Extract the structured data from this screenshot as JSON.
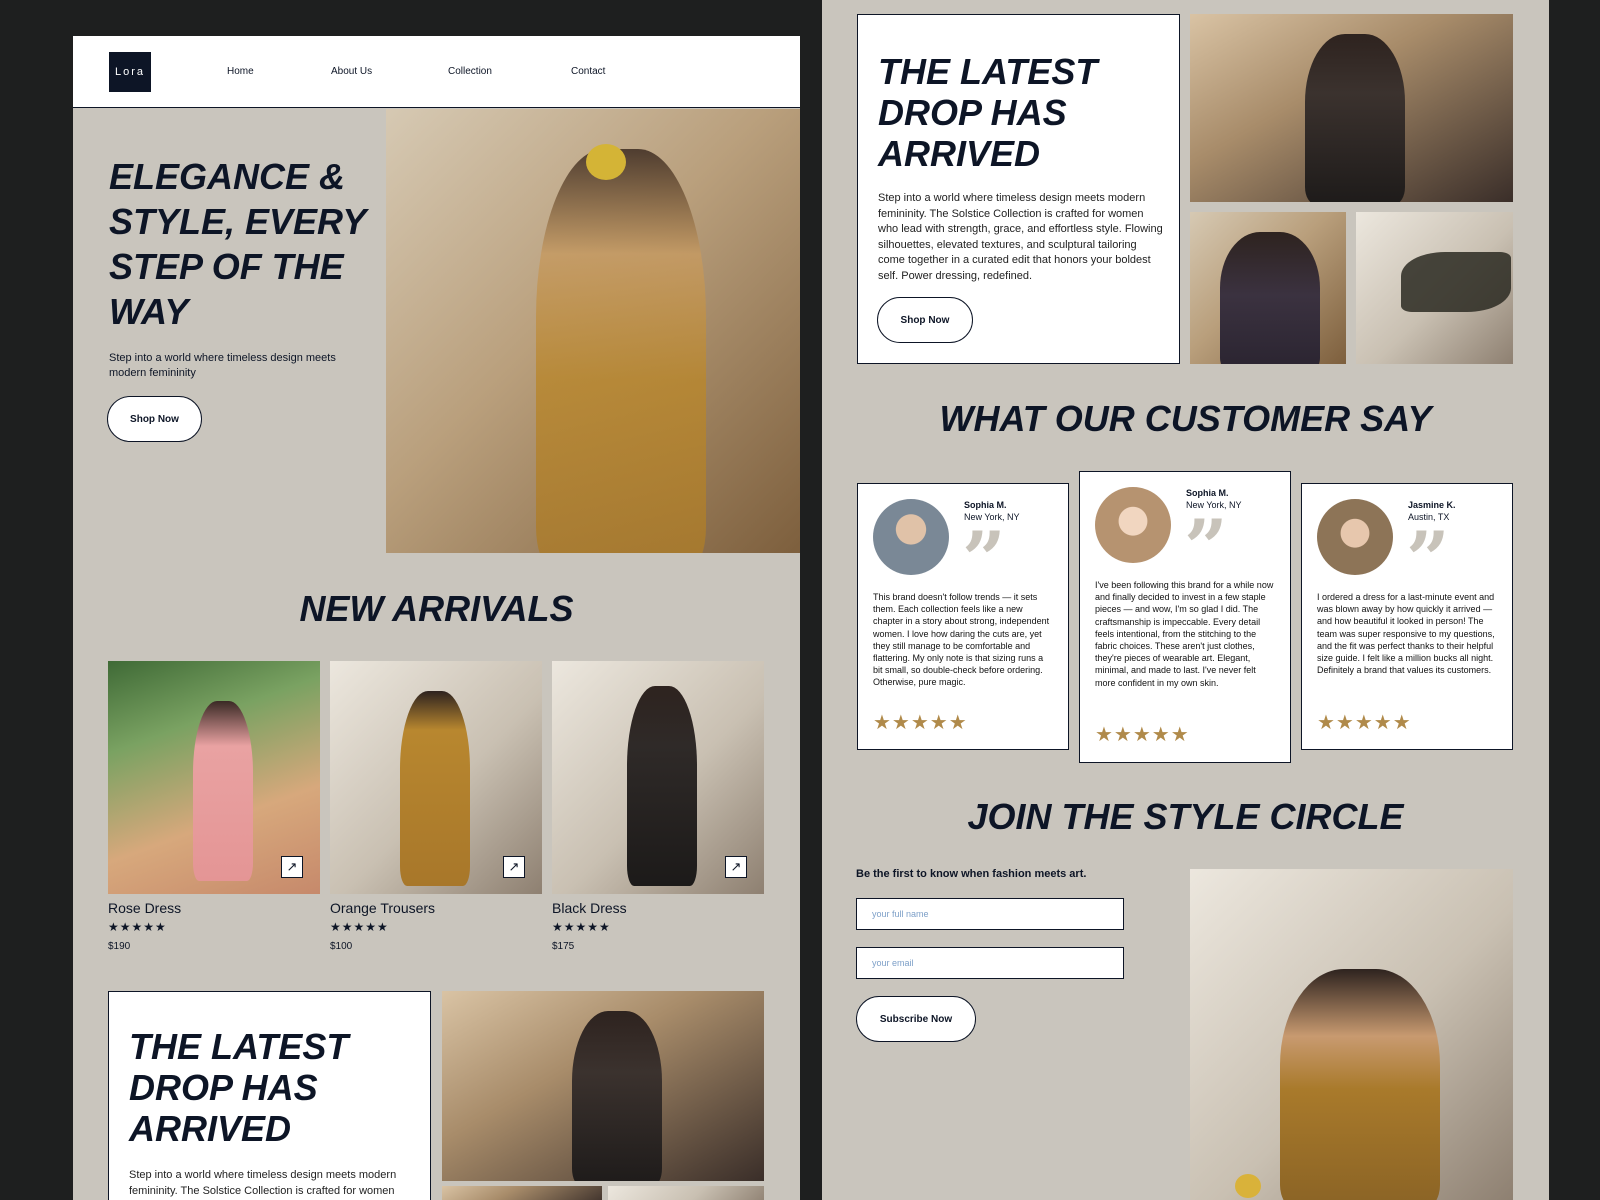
{
  "nav": {
    "logo": "Lora",
    "links": [
      "Home",
      "About Us",
      "Collection",
      "Contact"
    ]
  },
  "hero": {
    "title": "ELEGANCE & STYLE, EVERY STEP OF THE WAY",
    "subtitle": "Step into a world where timeless design meets modern femininity",
    "button": "Shop Now"
  },
  "new_arrivals": {
    "title": "NEW ARRIVALS",
    "products": [
      {
        "name": "Rose Dress",
        "stars": "★★★★★",
        "price": "$190"
      },
      {
        "name": "Orange Trousers",
        "stars": "★★★★★",
        "price": "$100"
      },
      {
        "name": "Black Dress",
        "stars": "★★★★★",
        "price": "$175"
      }
    ],
    "arrow_icon": "↗"
  },
  "latest_drop": {
    "title": "THE LATEST DROP HAS ARRIVED",
    "body": "Step into a world where timeless design meets modern femininity. The Solstice Collection is crafted for women who lead with strength, grace, and effortless style. Flowing silhouettes, elevated textures, and sculptural tailoring come together in a curated edit that honors your boldest self. Power dressing, redefined.",
    "body_short": "Step into a world where timeless design meets modern femininity. The Solstice Collection is crafted for women",
    "button": "Shop Now"
  },
  "testimonials": {
    "title": "WHAT OUR CUSTOMER SAY",
    "reviews": [
      {
        "name": "Sophia M.",
        "location": "New York, NY",
        "stars": "★★★★★",
        "text": "This brand doesn't follow trends — it sets them. Each collection feels like a new chapter in a story about strong, independent women. I love how daring the cuts are, yet they still manage to be comfortable and flattering. My only note is that sizing runs a bit small, so double-check before ordering. Otherwise, pure magic."
      },
      {
        "name": "Sophia M.",
        "location": "New York, NY",
        "stars": "★★★★★",
        "text": "I've been following this brand for a while now and finally decided to invest in a few staple pieces — and wow, I'm so glad I did. The craftsmanship is impeccable. Every detail feels intentional, from the stitching to the fabric choices. These aren't just clothes, they're pieces of wearable art. Elegant, minimal, and made to last. I've never felt more confident in my own skin."
      },
      {
        "name": "Jasmine K.",
        "location": "Austin, TX",
        "stars": "★★★★★",
        "text": "I ordered a dress for a last-minute event and was blown away by how quickly it arrived — and how beautiful it looked in person! The team was super responsive to my questions, and the fit was perfect thanks to their helpful size guide. I felt like a million bucks all night. Definitely a brand that values its customers."
      }
    ]
  },
  "newsletter": {
    "title": "JOIN THE STYLE CIRCLE",
    "lead": "Be the first to know when fashion meets art.",
    "name_placeholder": "your full name",
    "email_placeholder": "your email",
    "button": "Subscribe Now"
  }
}
